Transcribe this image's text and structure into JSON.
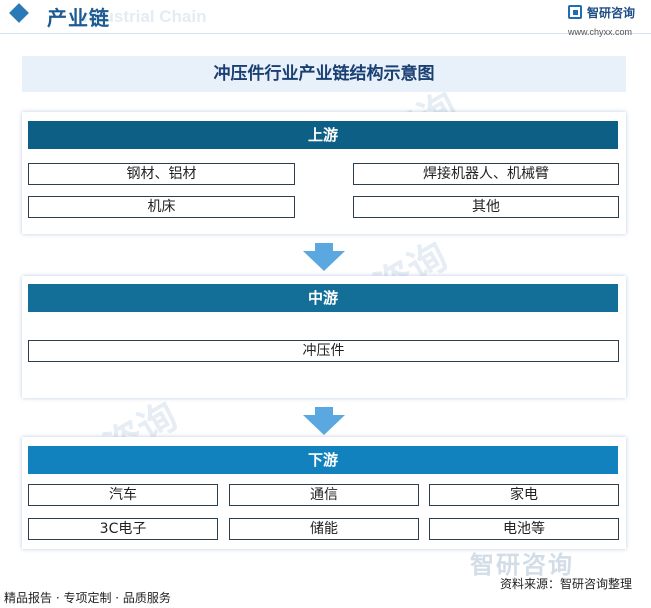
{
  "header": {
    "title": "产业链",
    "watermark_en": "Industrial Chain"
  },
  "logo": {
    "name": "智研咨询",
    "url": "www.chyxx.com",
    "icon": "zhiyan-logo-icon"
  },
  "diagram": {
    "title": "冲压件行业产业链结构示意图",
    "upstream": {
      "label": "上游",
      "items": [
        "钢材、铝材",
        "焊接机器人、机械臂",
        "机床",
        "其他"
      ]
    },
    "midstream": {
      "label": "中游",
      "items": [
        "冲压件"
      ]
    },
    "downstream": {
      "label": "下游",
      "items": [
        "汽车",
        "通信",
        "家电",
        "3C电子",
        "储能",
        "电池等"
      ]
    }
  },
  "colors": {
    "upstream_band": "#0e5f86",
    "midstream_band": "#136e98",
    "downstream_band": "#1282be",
    "arrow": "#5aa8df",
    "title_bg": "#e8f1fa"
  },
  "watermark": "智研咨询",
  "footer": {
    "left": "精品报告 · 专项定制 · 品质服务",
    "source": "资料来源：智研咨询整理",
    "bottom_logo": "智研咨询"
  }
}
